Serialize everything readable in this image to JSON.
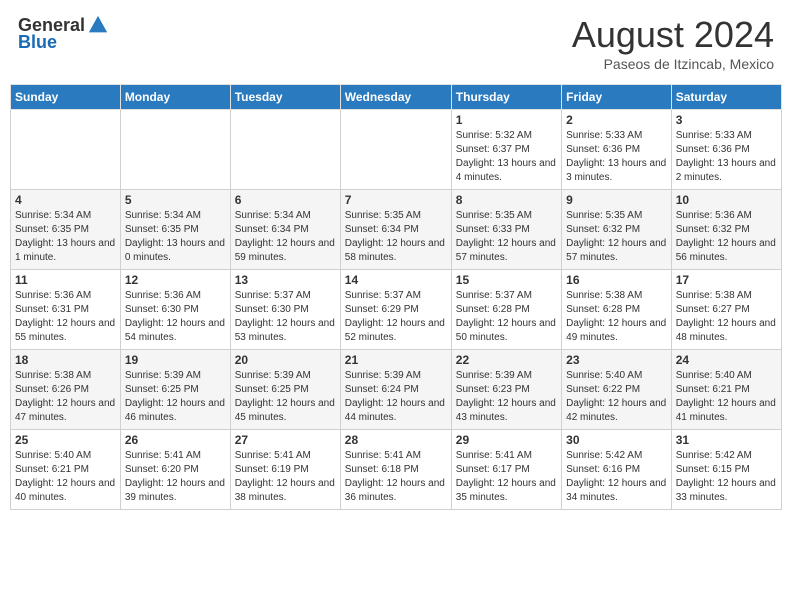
{
  "header": {
    "logo_general": "General",
    "logo_blue": "Blue",
    "month_title": "August 2024",
    "location": "Paseos de Itzincab, Mexico"
  },
  "weekdays": [
    "Sunday",
    "Monday",
    "Tuesday",
    "Wednesday",
    "Thursday",
    "Friday",
    "Saturday"
  ],
  "weeks": [
    [
      null,
      null,
      null,
      null,
      {
        "day": "1",
        "sunrise": "Sunrise: 5:32 AM",
        "sunset": "Sunset: 6:37 PM",
        "daylight": "Daylight: 13 hours and 4 minutes."
      },
      {
        "day": "2",
        "sunrise": "Sunrise: 5:33 AM",
        "sunset": "Sunset: 6:36 PM",
        "daylight": "Daylight: 13 hours and 3 minutes."
      },
      {
        "day": "3",
        "sunrise": "Sunrise: 5:33 AM",
        "sunset": "Sunset: 6:36 PM",
        "daylight": "Daylight: 13 hours and 2 minutes."
      }
    ],
    [
      {
        "day": "4",
        "sunrise": "Sunrise: 5:34 AM",
        "sunset": "Sunset: 6:35 PM",
        "daylight": "Daylight: 13 hours and 1 minute."
      },
      {
        "day": "5",
        "sunrise": "Sunrise: 5:34 AM",
        "sunset": "Sunset: 6:35 PM",
        "daylight": "Daylight: 13 hours and 0 minutes."
      },
      {
        "day": "6",
        "sunrise": "Sunrise: 5:34 AM",
        "sunset": "Sunset: 6:34 PM",
        "daylight": "Daylight: 12 hours and 59 minutes."
      },
      {
        "day": "7",
        "sunrise": "Sunrise: 5:35 AM",
        "sunset": "Sunset: 6:34 PM",
        "daylight": "Daylight: 12 hours and 58 minutes."
      },
      {
        "day": "8",
        "sunrise": "Sunrise: 5:35 AM",
        "sunset": "Sunset: 6:33 PM",
        "daylight": "Daylight: 12 hours and 57 minutes."
      },
      {
        "day": "9",
        "sunrise": "Sunrise: 5:35 AM",
        "sunset": "Sunset: 6:32 PM",
        "daylight": "Daylight: 12 hours and 57 minutes."
      },
      {
        "day": "10",
        "sunrise": "Sunrise: 5:36 AM",
        "sunset": "Sunset: 6:32 PM",
        "daylight": "Daylight: 12 hours and 56 minutes."
      }
    ],
    [
      {
        "day": "11",
        "sunrise": "Sunrise: 5:36 AM",
        "sunset": "Sunset: 6:31 PM",
        "daylight": "Daylight: 12 hours and 55 minutes."
      },
      {
        "day": "12",
        "sunrise": "Sunrise: 5:36 AM",
        "sunset": "Sunset: 6:30 PM",
        "daylight": "Daylight: 12 hours and 54 minutes."
      },
      {
        "day": "13",
        "sunrise": "Sunrise: 5:37 AM",
        "sunset": "Sunset: 6:30 PM",
        "daylight": "Daylight: 12 hours and 53 minutes."
      },
      {
        "day": "14",
        "sunrise": "Sunrise: 5:37 AM",
        "sunset": "Sunset: 6:29 PM",
        "daylight": "Daylight: 12 hours and 52 minutes."
      },
      {
        "day": "15",
        "sunrise": "Sunrise: 5:37 AM",
        "sunset": "Sunset: 6:28 PM",
        "daylight": "Daylight: 12 hours and 50 minutes."
      },
      {
        "day": "16",
        "sunrise": "Sunrise: 5:38 AM",
        "sunset": "Sunset: 6:28 PM",
        "daylight": "Daylight: 12 hours and 49 minutes."
      },
      {
        "day": "17",
        "sunrise": "Sunrise: 5:38 AM",
        "sunset": "Sunset: 6:27 PM",
        "daylight": "Daylight: 12 hours and 48 minutes."
      }
    ],
    [
      {
        "day": "18",
        "sunrise": "Sunrise: 5:38 AM",
        "sunset": "Sunset: 6:26 PM",
        "daylight": "Daylight: 12 hours and 47 minutes."
      },
      {
        "day": "19",
        "sunrise": "Sunrise: 5:39 AM",
        "sunset": "Sunset: 6:25 PM",
        "daylight": "Daylight: 12 hours and 46 minutes."
      },
      {
        "day": "20",
        "sunrise": "Sunrise: 5:39 AM",
        "sunset": "Sunset: 6:25 PM",
        "daylight": "Daylight: 12 hours and 45 minutes."
      },
      {
        "day": "21",
        "sunrise": "Sunrise: 5:39 AM",
        "sunset": "Sunset: 6:24 PM",
        "daylight": "Daylight: 12 hours and 44 minutes."
      },
      {
        "day": "22",
        "sunrise": "Sunrise: 5:39 AM",
        "sunset": "Sunset: 6:23 PM",
        "daylight": "Daylight: 12 hours and 43 minutes."
      },
      {
        "day": "23",
        "sunrise": "Sunrise: 5:40 AM",
        "sunset": "Sunset: 6:22 PM",
        "daylight": "Daylight: 12 hours and 42 minutes."
      },
      {
        "day": "24",
        "sunrise": "Sunrise: 5:40 AM",
        "sunset": "Sunset: 6:21 PM",
        "daylight": "Daylight: 12 hours and 41 minutes."
      }
    ],
    [
      {
        "day": "25",
        "sunrise": "Sunrise: 5:40 AM",
        "sunset": "Sunset: 6:21 PM",
        "daylight": "Daylight: 12 hours and 40 minutes."
      },
      {
        "day": "26",
        "sunrise": "Sunrise: 5:41 AM",
        "sunset": "Sunset: 6:20 PM",
        "daylight": "Daylight: 12 hours and 39 minutes."
      },
      {
        "day": "27",
        "sunrise": "Sunrise: 5:41 AM",
        "sunset": "Sunset: 6:19 PM",
        "daylight": "Daylight: 12 hours and 38 minutes."
      },
      {
        "day": "28",
        "sunrise": "Sunrise: 5:41 AM",
        "sunset": "Sunset: 6:18 PM",
        "daylight": "Daylight: 12 hours and 36 minutes."
      },
      {
        "day": "29",
        "sunrise": "Sunrise: 5:41 AM",
        "sunset": "Sunset: 6:17 PM",
        "daylight": "Daylight: 12 hours and 35 minutes."
      },
      {
        "day": "30",
        "sunrise": "Sunrise: 5:42 AM",
        "sunset": "Sunset: 6:16 PM",
        "daylight": "Daylight: 12 hours and 34 minutes."
      },
      {
        "day": "31",
        "sunrise": "Sunrise: 5:42 AM",
        "sunset": "Sunset: 6:15 PM",
        "daylight": "Daylight: 12 hours and 33 minutes."
      }
    ]
  ]
}
